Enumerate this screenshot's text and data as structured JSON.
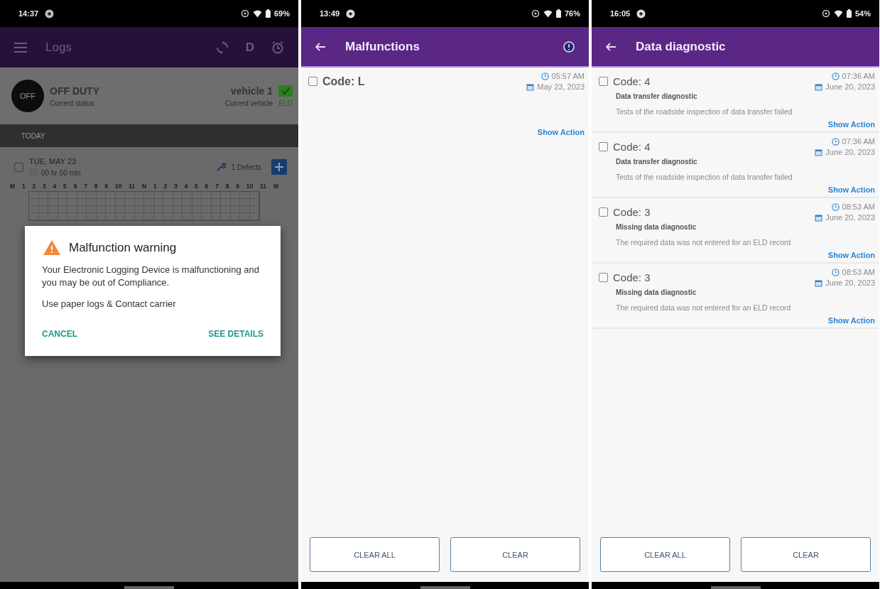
{
  "logs_screen": {
    "status_bar": {
      "time": "14:37",
      "battery": "69%"
    },
    "app_bar": {
      "title": "Logs",
      "action_letter": "D"
    },
    "status": {
      "badge": "OFF",
      "title": "OFF DUTY",
      "subtitle": "Current status"
    },
    "vehicle": {
      "name": "vehicle 1",
      "subtitle": "Current vehicle",
      "eld_label": "ELD"
    },
    "section": "TODAY",
    "log": {
      "date": "TUE, MAY 23",
      "duration": "00 hr 00 min",
      "defects": "1 Defects",
      "checked": false
    },
    "grid_hours": [
      "M",
      "1",
      "2",
      "3",
      "4",
      "5",
      "6",
      "7",
      "8",
      "9",
      "10",
      "11",
      "N",
      "1",
      "2",
      "3",
      "4",
      "5",
      "6",
      "7",
      "8",
      "9",
      "10",
      "11",
      "M"
    ],
    "dialog": {
      "title": "Malfunction warning",
      "message": "Your Electronic Logging Device is malfunctioning and you may be out of Compliance.",
      "advice": "Use paper logs & Contact carrier",
      "buttons": [
        "CANCEL",
        "SEE DETAILS"
      ]
    }
  },
  "list_screens": [
    {
      "status_bar": {
        "time": "13:49",
        "battery": "76%"
      },
      "title": "Malfunctions",
      "info_button": true,
      "items": [
        {
          "code": "Code: L",
          "time": "05:57 AM",
          "date": "May 23, 2023",
          "action": "Show Action",
          "checked": false
        }
      ],
      "buttons": [
        "CLEAR ALL",
        "CLEAR"
      ]
    },
    {
      "status_bar": {
        "time": "16:05",
        "battery": "54%"
      },
      "title": "Data diagnostic",
      "info_button": false,
      "items": [
        {
          "code": "Code: 4",
          "time": "07:36 AM",
          "date": "June 20, 2023",
          "title": "Data transfer diagnostic",
          "description": "Tests of the roadside inspection of data transfer failed",
          "action": "Show Action",
          "checked": false
        },
        {
          "code": "Code: 4",
          "time": "07:36 AM",
          "date": "June 20, 2023",
          "title": "Data transfer diagnostic",
          "description": "Tests of the roadside inspection of data transfer failed",
          "action": "Show Action",
          "checked": false
        },
        {
          "code": "Code: 3",
          "time": "08:53 AM",
          "date": "June 20, 2023",
          "title": "Missing data diagnostic",
          "description": "The required data was not entered for an ELD record",
          "action": "Show Action",
          "checked": false
        },
        {
          "code": "Code: 3",
          "time": "08:53 AM",
          "date": "June 20, 2023",
          "title": "Missing data diagnostic",
          "description": "The required data was not entered for an ELD record",
          "action": "Show Action",
          "checked": false
        }
      ],
      "buttons": [
        "CLEAR ALL",
        "CLEAR"
      ]
    }
  ]
}
